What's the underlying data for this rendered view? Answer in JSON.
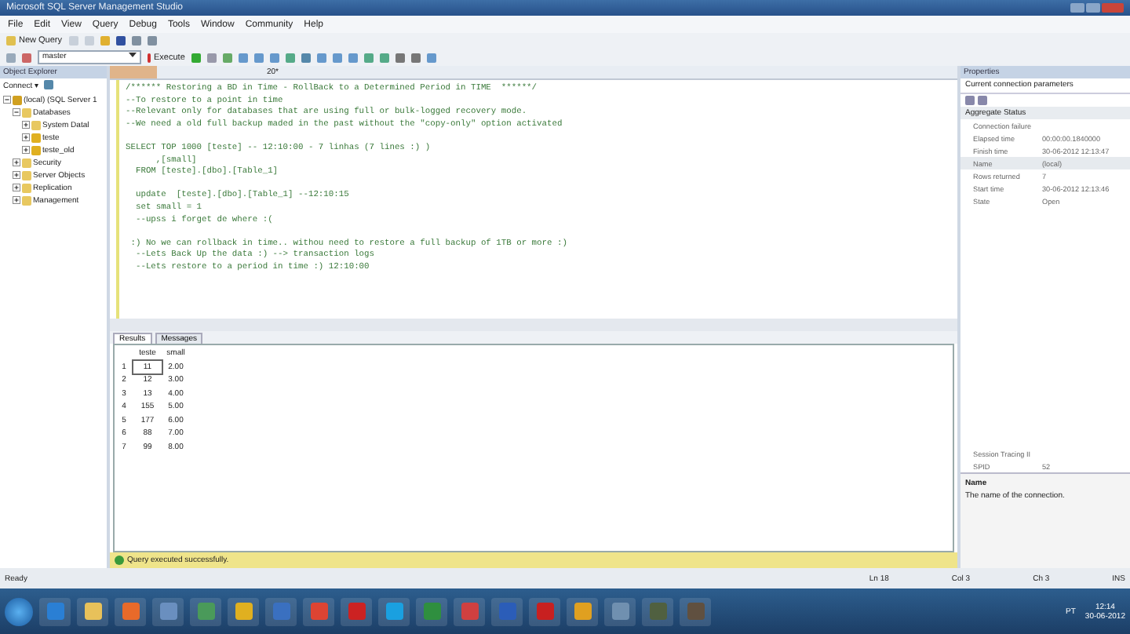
{
  "window": {
    "title": "Microsoft SQL Server Management Studio"
  },
  "menu": [
    "File",
    "Edit",
    "View",
    "Query",
    "Debug",
    "Tools",
    "Window",
    "Community",
    "Help"
  ],
  "toolbar": {
    "new_query": "New Query",
    "database": "master",
    "execute": "Execute"
  },
  "object_explorer": {
    "title": "Object Explorer",
    "connect": "Connect ▾",
    "tree": [
      {
        "label": "(local) (SQL Server 1",
        "kind": "server",
        "expanded": true,
        "children": [
          {
            "label": "Databases",
            "kind": "folder",
            "expanded": true,
            "children": [
              {
                "label": "System Datal",
                "kind": "folder",
                "expanded": false
              },
              {
                "label": "teste",
                "kind": "database",
                "expanded": false
              },
              {
                "label": "teste_old",
                "kind": "database",
                "expanded": false
              }
            ]
          },
          {
            "label": "Security",
            "kind": "folder",
            "expanded": false
          },
          {
            "label": "Server Objects",
            "kind": "folder",
            "expanded": false
          },
          {
            "label": "Replication",
            "kind": "folder",
            "expanded": false
          },
          {
            "label": "Management",
            "kind": "folder",
            "expanded": false
          }
        ]
      }
    ]
  },
  "editor": {
    "tab": "20*",
    "blocks": [
      [
        "/****** Restoring a BD in Time - RollBack to a Determined Period in TIME  ******/",
        "--To restore to a point in time",
        "--Relevant only for databases that are using full or bulk-logged recovery mode.",
        "--We need a old full backup maded in the past without the \"copy-only\" option activated"
      ],
      [
        "SELECT TOP 1000 [teste] -- 12:10:00 - 7 linhas (7 lines :) )",
        "      ,[small]",
        "  FROM [teste].[dbo].[Table_1]"
      ],
      [
        "  update  [teste].[dbo].[Table_1] --12:10:15",
        "  set small = 1",
        "  --upss i forget de where :("
      ],
      [
        " :) No we can rollback in time.. withou need to restore a full backup of 1TB or more :)",
        "  --Lets Back Up the data :) --> transaction logs",
        "  --Lets restore to a period in time :) 12:10:00"
      ]
    ]
  },
  "results": {
    "tabs": [
      {
        "label": "Results",
        "selected": true
      },
      {
        "label": "Messages",
        "selected": false
      }
    ],
    "columns": [
      "",
      "teste",
      "small"
    ],
    "rows": [
      [
        "1",
        "11",
        "2.00"
      ],
      [
        "2",
        "12",
        "3.00"
      ],
      [
        "3",
        "13",
        "4.00"
      ],
      [
        "4",
        "155",
        "5.00"
      ],
      [
        "5",
        "177",
        "6.00"
      ],
      [
        "6",
        "88",
        "7.00"
      ],
      [
        "7",
        "99",
        "8.00"
      ]
    ],
    "message": "Query executed successfully."
  },
  "properties": {
    "title": "Properties",
    "object": "Current connection parameters",
    "section": "Aggregate Status",
    "rows": [
      [
        "Connection failure",
        ""
      ],
      [
        "Elapsed time",
        "00:00:00.1840000"
      ],
      [
        "Finish time",
        "30-06-2012 12:13:47"
      ],
      [
        "Name",
        "(local)"
      ],
      [
        "Rows returned",
        "7"
      ],
      [
        "Start time",
        "30-06-2012 12:13:46"
      ],
      [
        "State",
        "Open"
      ]
    ],
    "lower_rows": [
      [
        "Session Tracing II",
        ""
      ],
      [
        "SPID",
        "52"
      ]
    ],
    "description_title": "Name",
    "description": "The name of the connection."
  },
  "status_bar": {
    "state": "Ready",
    "line": "Ln 18",
    "col": "Col 3",
    "ch": "Ch 3",
    "mode": "INS"
  },
  "taskbar": {
    "language": "PT",
    "time": "12:14",
    "date": "30-06-2012"
  }
}
